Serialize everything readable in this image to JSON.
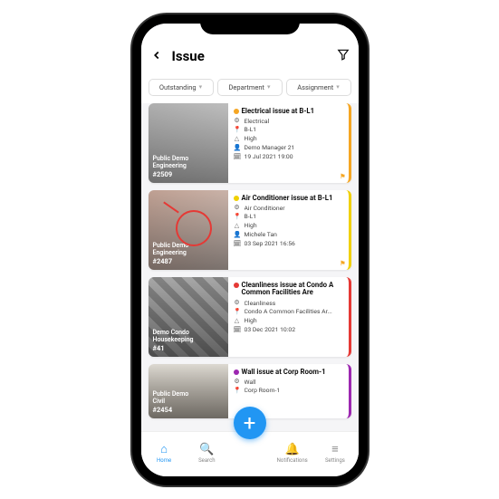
{
  "header": {
    "title": "Issue"
  },
  "filters": {
    "status": "Outstanding",
    "department": "Department",
    "assignment": "Assignment"
  },
  "tabs": {
    "home": "Home",
    "search": "Search",
    "notifications": "Notifications",
    "settings": "Settings"
  },
  "issues": [
    {
      "thumb_line1": "Public Demo",
      "thumb_line2": "Engineering",
      "thumb_id": "#2509",
      "title": "Electrical issue at B-L1",
      "category": "Electrical",
      "location": "B-L1",
      "priority": "High",
      "assignee": "Demo Manager 21",
      "date": "19 Jul 2021 19:00",
      "color": "orange"
    },
    {
      "thumb_line1": "Public Demo",
      "thumb_line2": "Engineering",
      "thumb_id": "#2487",
      "title": "Air Conditioner issue at B-L1",
      "category": "Air Conditioner",
      "location": "B-L1",
      "priority": "High",
      "assignee": "Michele Tan",
      "date": "03 Sep 2021 16:56",
      "color": "yellow"
    },
    {
      "thumb_line1": "Demo Condo",
      "thumb_line2": "Housekeeping",
      "thumb_id": "#41",
      "title": "Cleanliness issue at Condo A Common Facilities Are",
      "category": "Cleanliness",
      "location": "Condo A Common Facilities Ar...",
      "priority": "High",
      "assignee": "",
      "date": "03 Dec 2021 10:02",
      "color": "red"
    },
    {
      "thumb_line1": "Public Demo",
      "thumb_line2": "Civil",
      "thumb_id": "#2454",
      "title": "Wall issue at Corp Room-1",
      "category": "Wall",
      "location": "Corp Room-1",
      "priority": "",
      "assignee": "",
      "date": "",
      "color": "purple"
    }
  ]
}
